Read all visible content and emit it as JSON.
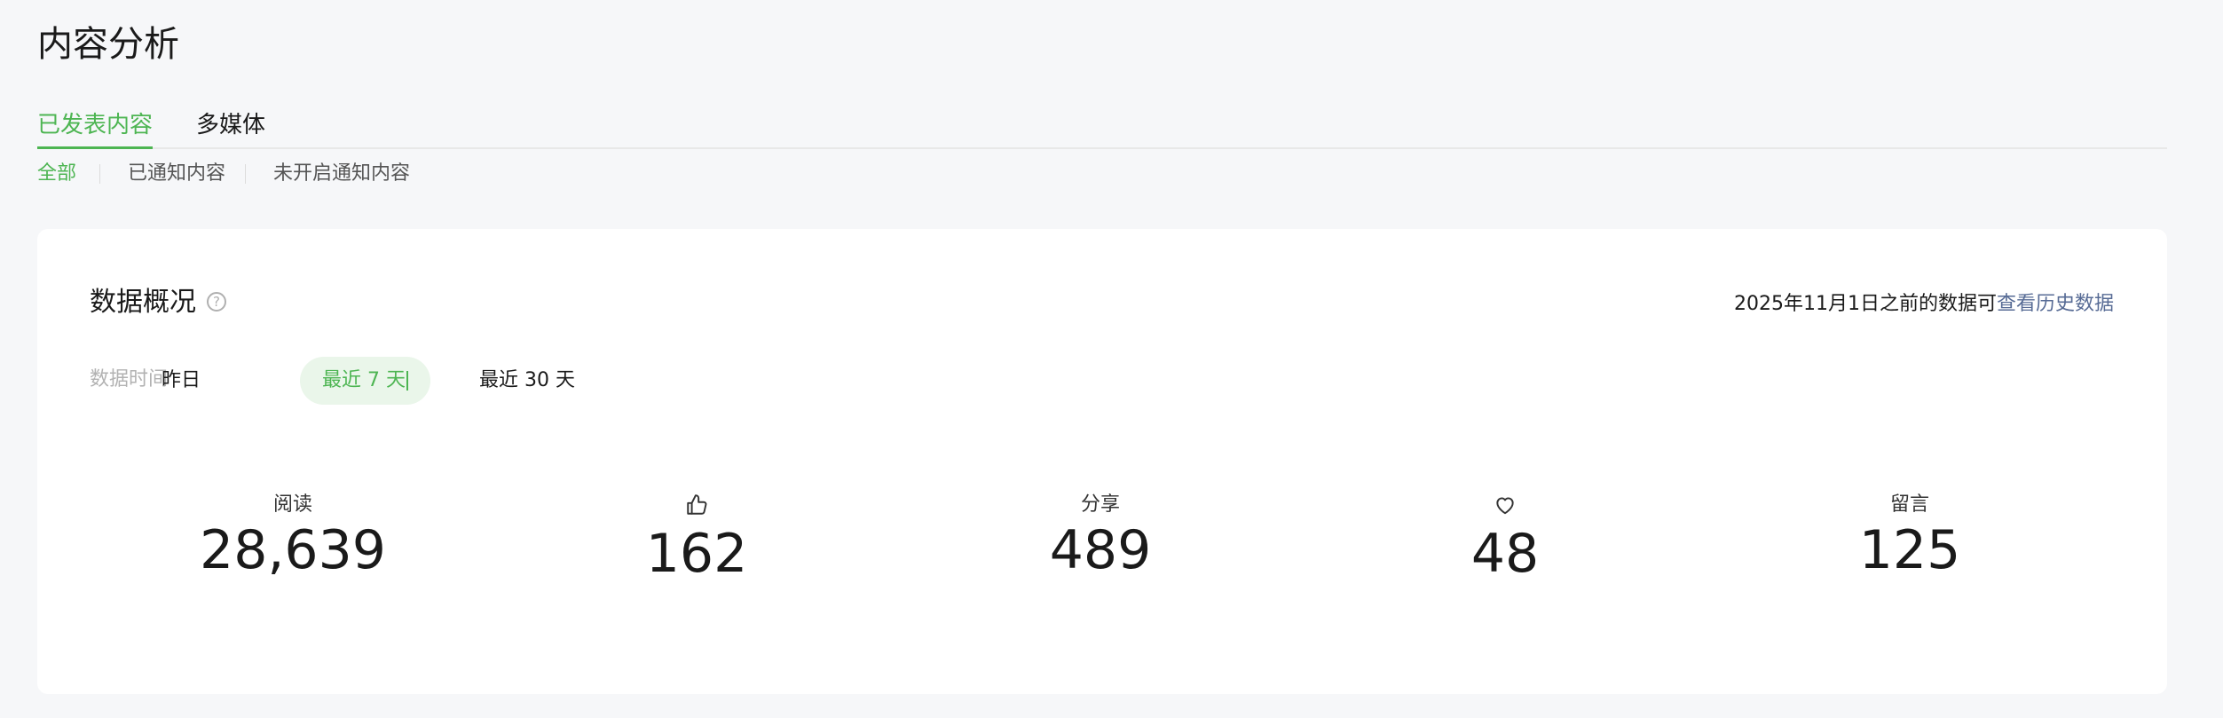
{
  "page": {
    "title": "内容分析"
  },
  "tabs": [
    {
      "label": "已发表内容",
      "active": true
    },
    {
      "label": "多媒体",
      "active": false
    }
  ],
  "subtabs": [
    {
      "label": "全部",
      "active": true
    },
    {
      "label": "已通知内容",
      "active": false
    },
    {
      "label": "未开启通知内容",
      "active": false
    }
  ],
  "overview": {
    "title": "数据概况",
    "help_icon": "question-circle-icon",
    "history_prefix": "2025年11月1日之前的数据可",
    "history_link": "查看历史数据",
    "time_label": "数据时间",
    "time_options": [
      {
        "label": "昨日",
        "active": false
      },
      {
        "label": "最近 7 天",
        "active": true
      },
      {
        "label": "最近 30 天",
        "active": false
      }
    ],
    "metrics": [
      {
        "label": "阅读",
        "value": "28,639"
      },
      {
        "icon": "thumbs-up-icon",
        "value": "162"
      },
      {
        "label": "分享",
        "value": "489"
      },
      {
        "icon": "heart-icon",
        "value": "48"
      },
      {
        "label": "留言",
        "value": "125"
      }
    ]
  },
  "colors": {
    "accent": "#4db552",
    "accent_bg": "#eaf6ea",
    "link": "#576b95",
    "page_bg": "#f6f7f9",
    "card_bg": "#ffffff"
  }
}
